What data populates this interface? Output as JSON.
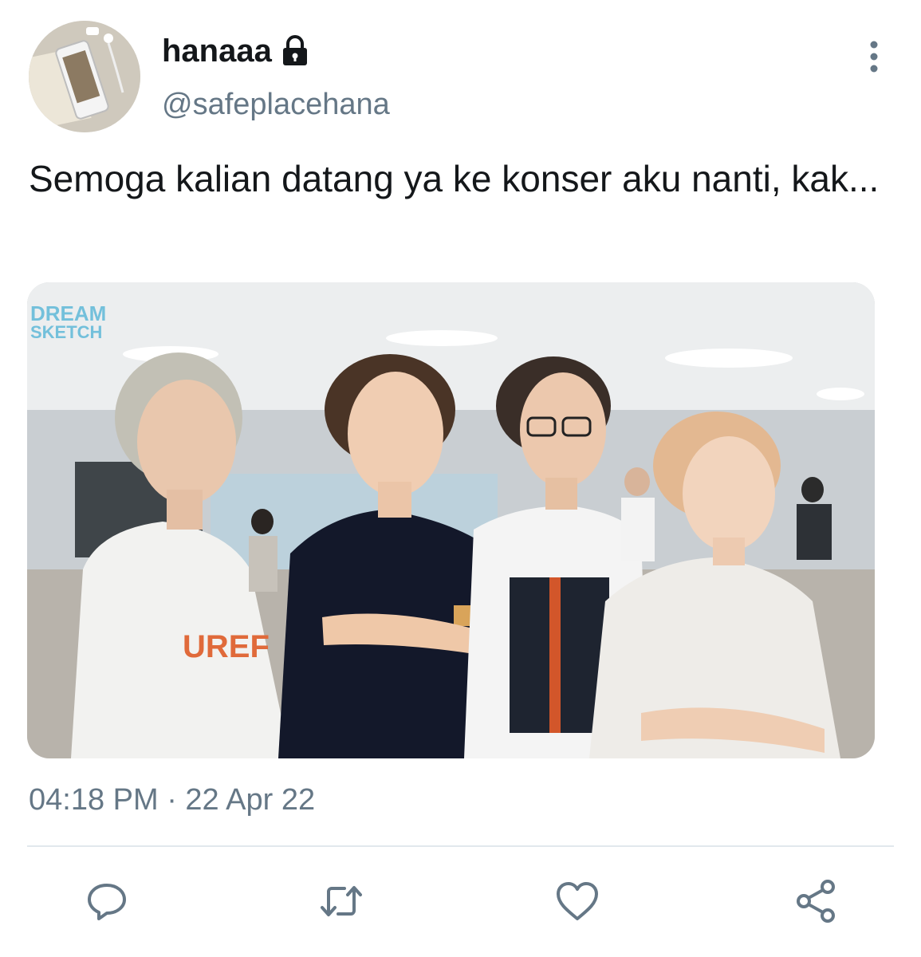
{
  "tweet": {
    "author": {
      "display_name": "hanaaa",
      "handle": "@safeplacehana",
      "protected_icon": "lock-icon",
      "avatar_icon": "avatar-image"
    },
    "text": "Semoga kalian datang ya ke konser aku nanti, kak...",
    "media": {
      "watermark_line1": "DREAM",
      "watermark_line2": "SKETCH",
      "shirt_text": "UREF"
    },
    "timestamp": "04:18 PM · 22 Apr 22"
  },
  "actions": {
    "reply_icon": "reply-icon",
    "retweet_icon": "retweet-icon",
    "like_icon": "like-icon",
    "share_icon": "share-icon",
    "more_icon": "more-options-icon"
  },
  "colors": {
    "text_primary": "#14171a",
    "text_secondary": "#657786",
    "icon": "#657786",
    "divider": "#e1e8ed"
  }
}
